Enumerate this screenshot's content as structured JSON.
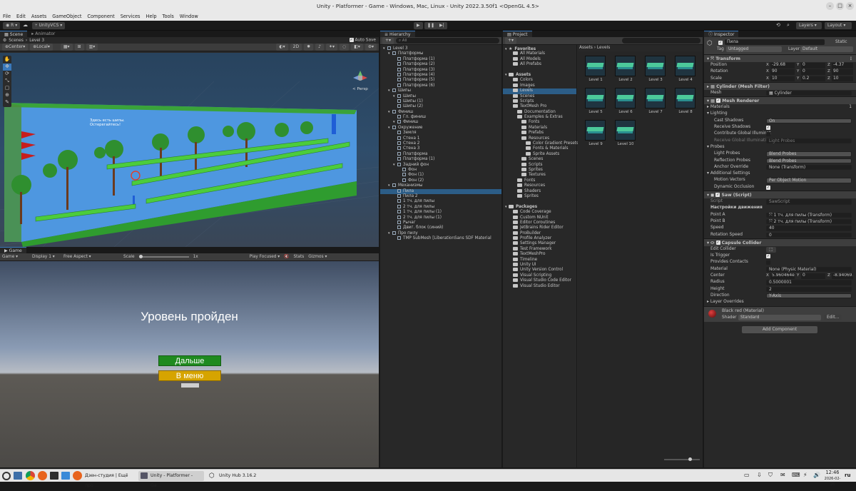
{
  "window": {
    "title": "Unity - Platformer - Game - Windows, Mac, Linux - Unity 2022.3.50f1 <OpenGL 4.5>"
  },
  "menu": [
    "File",
    "Edit",
    "Assets",
    "GameObject",
    "Component",
    "Services",
    "Help",
    "Tools",
    "Window"
  ],
  "toolbar": {
    "account": "R",
    "vcs": "UnityVCS",
    "layers": "Layers",
    "layout": "Layout"
  },
  "scene": {
    "tabs": [
      "Scene",
      "Animator"
    ],
    "breadcrumb_scenes": "Scenes",
    "breadcrumb_level": "Level 3",
    "auto_save": "Auto Save",
    "pivot": "Center",
    "space": "Local",
    "mode_2d": "2D",
    "persp": "< Persp",
    "sign_text": "Здесь есть шипы.\nОстерегайтесь!"
  },
  "game": {
    "tab": "Game",
    "display_mode": "Game",
    "display": "Display 1",
    "aspect": "Free Aspect",
    "scale_label": "Scale",
    "scale_value": "1x",
    "play_focused": "Play Focused",
    "stats": "Stats",
    "gizmos": "Gizmos",
    "level_complete": "Уровень пройден",
    "btn_next": "Дальше",
    "btn_menu": "В меню"
  },
  "hierarchy": {
    "tab": "Hierarchy",
    "search_placeholder": "All",
    "items": [
      {
        "label": "Level 3",
        "depth": 0,
        "type": "scene"
      },
      {
        "label": "Платформы",
        "depth": 1,
        "type": "obj"
      },
      {
        "label": "Платформа (1)",
        "depth": 2,
        "type": "obj"
      },
      {
        "label": "Платформа (2)",
        "depth": 2,
        "type": "obj"
      },
      {
        "label": "Платформа (3)",
        "depth": 2,
        "type": "obj"
      },
      {
        "label": "Платформа (4)",
        "depth": 2,
        "type": "obj"
      },
      {
        "label": "Платформа (5)",
        "depth": 2,
        "type": "obj"
      },
      {
        "label": "Платформа (6)",
        "depth": 2,
        "type": "obj"
      },
      {
        "label": "Шипы",
        "depth": 1,
        "type": "obj"
      },
      {
        "label": "Шипы",
        "depth": 2,
        "type": "obj"
      },
      {
        "label": "Шипы (1)",
        "depth": 2,
        "type": "obj"
      },
      {
        "label": "Шипы (2)",
        "depth": 2,
        "type": "obj"
      },
      {
        "label": "Финиш",
        "depth": 1,
        "type": "obj"
      },
      {
        "label": "Гл. финиш",
        "depth": 2,
        "type": "obj"
      },
      {
        "label": "Финиш",
        "depth": 2,
        "type": "obj"
      },
      {
        "label": "Окружение",
        "depth": 1,
        "type": "obj"
      },
      {
        "label": "Земля",
        "depth": 2,
        "type": "obj"
      },
      {
        "label": "Стена 1",
        "depth": 2,
        "type": "obj"
      },
      {
        "label": "Стена 2",
        "depth": 2,
        "type": "obj"
      },
      {
        "label": "Стена 3",
        "depth": 2,
        "type": "obj"
      },
      {
        "label": "Платформа",
        "depth": 2,
        "type": "obj"
      },
      {
        "label": "Платформа (1)",
        "depth": 2,
        "type": "obj"
      },
      {
        "label": "Задний фон",
        "depth": 2,
        "type": "obj"
      },
      {
        "label": "Фон",
        "depth": 3,
        "type": "obj"
      },
      {
        "label": "Фон (1)",
        "depth": 3,
        "type": "obj"
      },
      {
        "label": "Фон (2)",
        "depth": 3,
        "type": "obj"
      },
      {
        "label": "Механизмы",
        "depth": 1,
        "type": "obj"
      },
      {
        "label": "Пила",
        "depth": 2,
        "type": "obj",
        "selected": true
      },
      {
        "label": "Пила 2",
        "depth": 2,
        "type": "obj"
      },
      {
        "label": "1 тч. для пилы",
        "depth": 2,
        "type": "obj"
      },
      {
        "label": "2 тч. для пилы",
        "depth": 2,
        "type": "obj"
      },
      {
        "label": "1 тч. для пилы (1)",
        "depth": 2,
        "type": "obj"
      },
      {
        "label": "2 тч. для пилы  (1)",
        "depth": 2,
        "type": "obj"
      },
      {
        "label": "Рычаг",
        "depth": 2,
        "type": "obj"
      },
      {
        "label": "Двиг. блок (синий)",
        "depth": 2,
        "type": "obj"
      },
      {
        "label": "Про пилу",
        "depth": 1,
        "type": "obj"
      },
      {
        "label": "TMP SubMesh [LiberationSans SDF Material",
        "depth": 2,
        "type": "obj"
      }
    ]
  },
  "project": {
    "tab": "Project",
    "breadcrumb_root": "Assets",
    "breadcrumb_leaf": "Levels",
    "tree": [
      {
        "label": "Favorites",
        "depth": 0,
        "bold": true
      },
      {
        "label": "All Materials",
        "depth": 1
      },
      {
        "label": "All Models",
        "depth": 1
      },
      {
        "label": "All Prefabs",
        "depth": 1
      },
      {
        "label": "",
        "depth": 0
      },
      {
        "label": "Assets",
        "depth": 0,
        "bold": true
      },
      {
        "label": "Colors",
        "depth": 1
      },
      {
        "label": "Images",
        "depth": 1
      },
      {
        "label": "Levels",
        "depth": 1,
        "selected": true
      },
      {
        "label": "Scenes",
        "depth": 1
      },
      {
        "label": "Scripts",
        "depth": 1
      },
      {
        "label": "TextMesh Pro",
        "depth": 1
      },
      {
        "label": "Documentation",
        "depth": 2
      },
      {
        "label": "Examples & Extras",
        "depth": 2
      },
      {
        "label": "Fonts",
        "depth": 3
      },
      {
        "label": "Materials",
        "depth": 3
      },
      {
        "label": "Prefabs",
        "depth": 3
      },
      {
        "label": "Resources",
        "depth": 3
      },
      {
        "label": "Color Gradient Presets",
        "depth": 4
      },
      {
        "label": "Fonts & Materials",
        "depth": 4
      },
      {
        "label": "Sprite Assets",
        "depth": 4
      },
      {
        "label": "Scenes",
        "depth": 3
      },
      {
        "label": "Scripts",
        "depth": 3
      },
      {
        "label": "Sprites",
        "depth": 3
      },
      {
        "label": "Textures",
        "depth": 3
      },
      {
        "label": "Fonts",
        "depth": 2
      },
      {
        "label": "Resources",
        "depth": 2
      },
      {
        "label": "Shaders",
        "depth": 2
      },
      {
        "label": "Sprites",
        "depth": 2
      },
      {
        "label": "",
        "depth": 0
      },
      {
        "label": "Packages",
        "depth": 0,
        "bold": true
      },
      {
        "label": "Code Coverage",
        "depth": 1
      },
      {
        "label": "Custom NUnit",
        "depth": 1
      },
      {
        "label": "Editor Coroutines",
        "depth": 1
      },
      {
        "label": "JetBrains Rider Editor",
        "depth": 1
      },
      {
        "label": "ProBuilder",
        "depth": 1
      },
      {
        "label": "Profile Analyzer",
        "depth": 1
      },
      {
        "label": "Settings Manager",
        "depth": 1
      },
      {
        "label": "Test Framework",
        "depth": 1
      },
      {
        "label": "TextMeshPro",
        "depth": 1
      },
      {
        "label": "Timeline",
        "depth": 1
      },
      {
        "label": "Unity UI",
        "depth": 1
      },
      {
        "label": "Unity Version Control",
        "depth": 1
      },
      {
        "label": "Visual Scripting",
        "depth": 1
      },
      {
        "label": "Visual Studio Code Editor",
        "depth": 1
      },
      {
        "label": "Visual Studio Editor",
        "depth": 1
      }
    ],
    "levels": [
      "Level 1",
      "Level 2",
      "Level 3",
      "Level 4",
      "Level 5",
      "Level 6",
      "Level 7",
      "Level 8",
      "Level 9",
      "Level 10"
    ]
  },
  "inspector": {
    "tab": "Inspector",
    "object_name": "Пила",
    "static_label": "Static",
    "tag_label": "Tag",
    "tag_value": "Untagged",
    "layer_label": "Layer",
    "layer_value": "Default",
    "transform": {
      "title": "Transform",
      "rows": [
        {
          "label": "Position",
          "x": "-29.68",
          "y": "0",
          "z": "-4.37"
        },
        {
          "label": "Rotation",
          "x": "90",
          "y": "0",
          "z": "90"
        },
        {
          "label": "Scale",
          "x": "10",
          "y": "0.2",
          "z": "10"
        }
      ]
    },
    "mesh_filter": {
      "title": "Cylinder (Mesh Filter)",
      "mesh_label": "Mesh",
      "mesh_value": "Cylinder"
    },
    "mesh_renderer": {
      "title": "Mesh Renderer",
      "materials_label": "Materials",
      "materials_count": "1",
      "lighting_label": "Lighting",
      "cast_shadows_label": "Cast Shadows",
      "cast_shadows_value": "On",
      "receive_shadows_label": "Receive Shadows",
      "contribute_gi_label": "Contribute Global Illuminat",
      "receive_gi_label": "Receive Global Illuminatior",
      "receive_gi_value": "Light Probes",
      "probes_label": "Probes",
      "light_probes_label": "Light Probes",
      "light_probes_value": "Blend Probes",
      "reflection_probes_label": "Reflection Probes",
      "reflection_probes_value": "Blend Probes",
      "anchor_override_label": "Anchor Override",
      "anchor_override_value": "None (Transform)",
      "additional_label": "Additional Settings",
      "motion_vectors_label": "Motion Vectors",
      "motion_vectors_value": "Per Object Motion",
      "dynamic_occlusion_label": "Dynamic Occlusion"
    },
    "saw_script": {
      "title": "Saw (Script)",
      "script_label": "Script",
      "script_value": "SawScript",
      "section": "Настройки движения",
      "point_a_label": "Point A",
      "point_a_value": "1 тч. для пилы (Transform)",
      "point_b_label": "Point B",
      "point_b_value": "2 тч. для пилы  (Transform)",
      "speed_label": "Speed",
      "speed_value": "40",
      "rotation_speed_label": "Rotation Speed",
      "rotation_speed_value": "0"
    },
    "capsule": {
      "title": "Capsule Collider",
      "edit_collider_label": "Edit Collider",
      "is_trigger_label": "Is Trigger",
      "provides_contacts_label": "Provides Contacts",
      "material_label": "Material",
      "material_value": "None (Physic Material)",
      "center_label": "Center",
      "center_x": "5.960464e-",
      "center_y": "0",
      "center_z": "-8.940697e",
      "radius_label": "Radius",
      "radius_value": "0.5000001",
      "height_label": "Height",
      "height_value": "2",
      "direction_label": "Direction",
      "direction_value": "Y-Axis",
      "layer_overrides_label": "Layer Overrides"
    },
    "material": {
      "name": "Black red (Material)",
      "shader_label": "Shader",
      "shader_value": "Standard",
      "edit_label": "Edit..."
    },
    "add_component": "Add Component"
  },
  "taskbar": {
    "tasks": [
      "Дзен-студия | Ещё про ...",
      "Unity - Platformer - Ga...",
      "Unity Hub 3.16.2"
    ],
    "time": "12:46",
    "date": "2026-02-26",
    "lang": "ru"
  },
  "colors": {
    "accent": "#3a79bb",
    "selection": "#2c5d87",
    "game_btn_green": "#1f8a1f",
    "game_btn_yellow": "#d6a400"
  }
}
